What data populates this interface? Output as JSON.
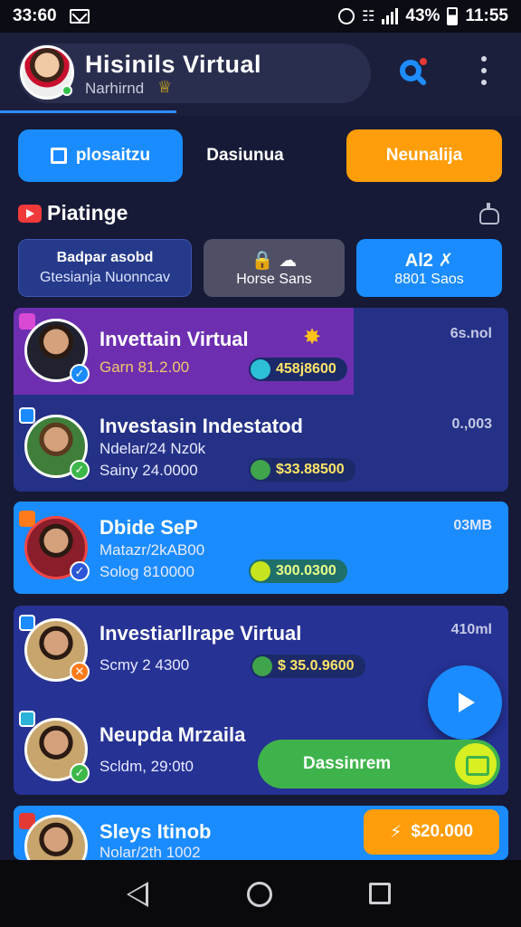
{
  "status_bar": {
    "time_left": "33:60",
    "battery": "43%",
    "clock": "11:55"
  },
  "header": {
    "title": "Hisinils Virtual",
    "subtitle": "Narhirnd",
    "badge_icon": "crown-icon"
  },
  "tabs": [
    {
      "label": "plosaitzu",
      "style": "primary"
    },
    {
      "label": "Dasiunua",
      "style": "plain"
    },
    {
      "label": "Neunalija",
      "style": "orange"
    }
  ],
  "section": {
    "title": "Piatinge"
  },
  "chips": [
    {
      "line1": "Badpar asobd",
      "line2": "Gtesianja Nuonncav"
    },
    {
      "line1": "Horse Sans"
    },
    {
      "line1": "Al2",
      "line2": "8801 Saos"
    }
  ],
  "list": [
    {
      "title": "Invettain Virtual",
      "sub": "Garn 81.2.00",
      "price": "458j8600",
      "right": "6s.nol"
    },
    {
      "title": "Investasin Indestatod",
      "meta": "Ndelar/24 Nz0k",
      "sub": "Sainy 24.0000",
      "price": "$33.88500",
      "right": "0.,003"
    },
    {
      "title": "Dbide SeP",
      "meta": "Matazr/2kAB00",
      "sub": "Solog 810000",
      "price": "300.0300",
      "right": "03MB"
    },
    {
      "title": "Investiarllrape Virtual",
      "sub": "Scmy 2 4300",
      "price": "$ 35.0.9600",
      "right": "410ml"
    },
    {
      "title": "Neupda Mrzaila",
      "sub": "Scldm, 29:0t0"
    },
    {
      "title": "Sleys Itinob",
      "meta": "Nolar/2th 1002"
    }
  ],
  "actions": {
    "cta_label": "Dassinrem",
    "orange_amount": "$20.000"
  },
  "colors": {
    "accent_blue": "#1a8cff",
    "accent_orange": "#ff9d0a",
    "accent_green": "#3fb34b",
    "background": "#161a36"
  }
}
